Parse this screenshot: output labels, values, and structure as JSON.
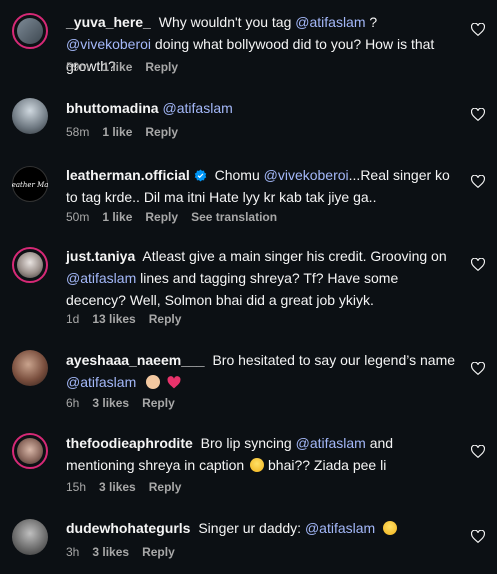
{
  "comments": [
    {
      "username": "_yuva_here_",
      "text1": " Why wouldn't you tag ",
      "mention1": "@atifaslam",
      "text2": " ? ",
      "mention2": "@vivekoberoi",
      "text3": " doing what bollywood did to you? How is that growth?",
      "time": "59m",
      "likes": "1 like",
      "reply": "Reply"
    },
    {
      "username": "bhuttomadina",
      "mention1": "@atifaslam",
      "time": "58m",
      "likes": "1 like",
      "reply": "Reply"
    },
    {
      "username": "leatherman.official",
      "avatar_text": "Leather Man",
      "text1": " Chomu ",
      "mention1": "@vivekoberoi",
      "text2": "...Real singer ko to tag krde.. Dil ma itni Hate lyy kr kab tak jiye ga..",
      "time": "50m",
      "likes": "1 like",
      "reply": "Reply",
      "translate": "See translation"
    },
    {
      "username": "just.taniya",
      "text1": " Atleast give a main singer his credit. Grooving on ",
      "mention1": "@atifaslam",
      "text2": " lines and tagging shreya? Tf? Have some decency? Well, Solmon bhai did a great job ykiyk.",
      "time": "1d",
      "likes": "13 likes",
      "reply": "Reply"
    },
    {
      "username": "ayeshaaa_naeem___",
      "text1": " Bro hesitated to say our legend’s name ",
      "mention1": "@atifaslam",
      "time": "6h",
      "likes": "3 likes",
      "reply": "Reply"
    },
    {
      "username": "thefoodieaphrodite",
      "text1": " Bro lip syncing ",
      "mention1": "@atifaslam",
      "text2": " and mentioning shreya in caption ",
      "text3": "  bhai?? Ziada pee li",
      "time": "15h",
      "likes": "3 likes",
      "reply": "Reply"
    },
    {
      "username": "dudewhohategurls",
      "text1": " Singer ur daddy: ",
      "mention1": "@atifaslam",
      "time": "3h",
      "likes": "3 likes",
      "reply": "Reply"
    }
  ],
  "colors": {
    "background": "#0c1014",
    "mention": "#a4b8f9",
    "meta": "#a8a8a8",
    "verified": "#0095f6",
    "story_ring": "#d62976"
  },
  "icons": {
    "like": "heart-outline-icon",
    "verified": "verified-badge-icon"
  }
}
